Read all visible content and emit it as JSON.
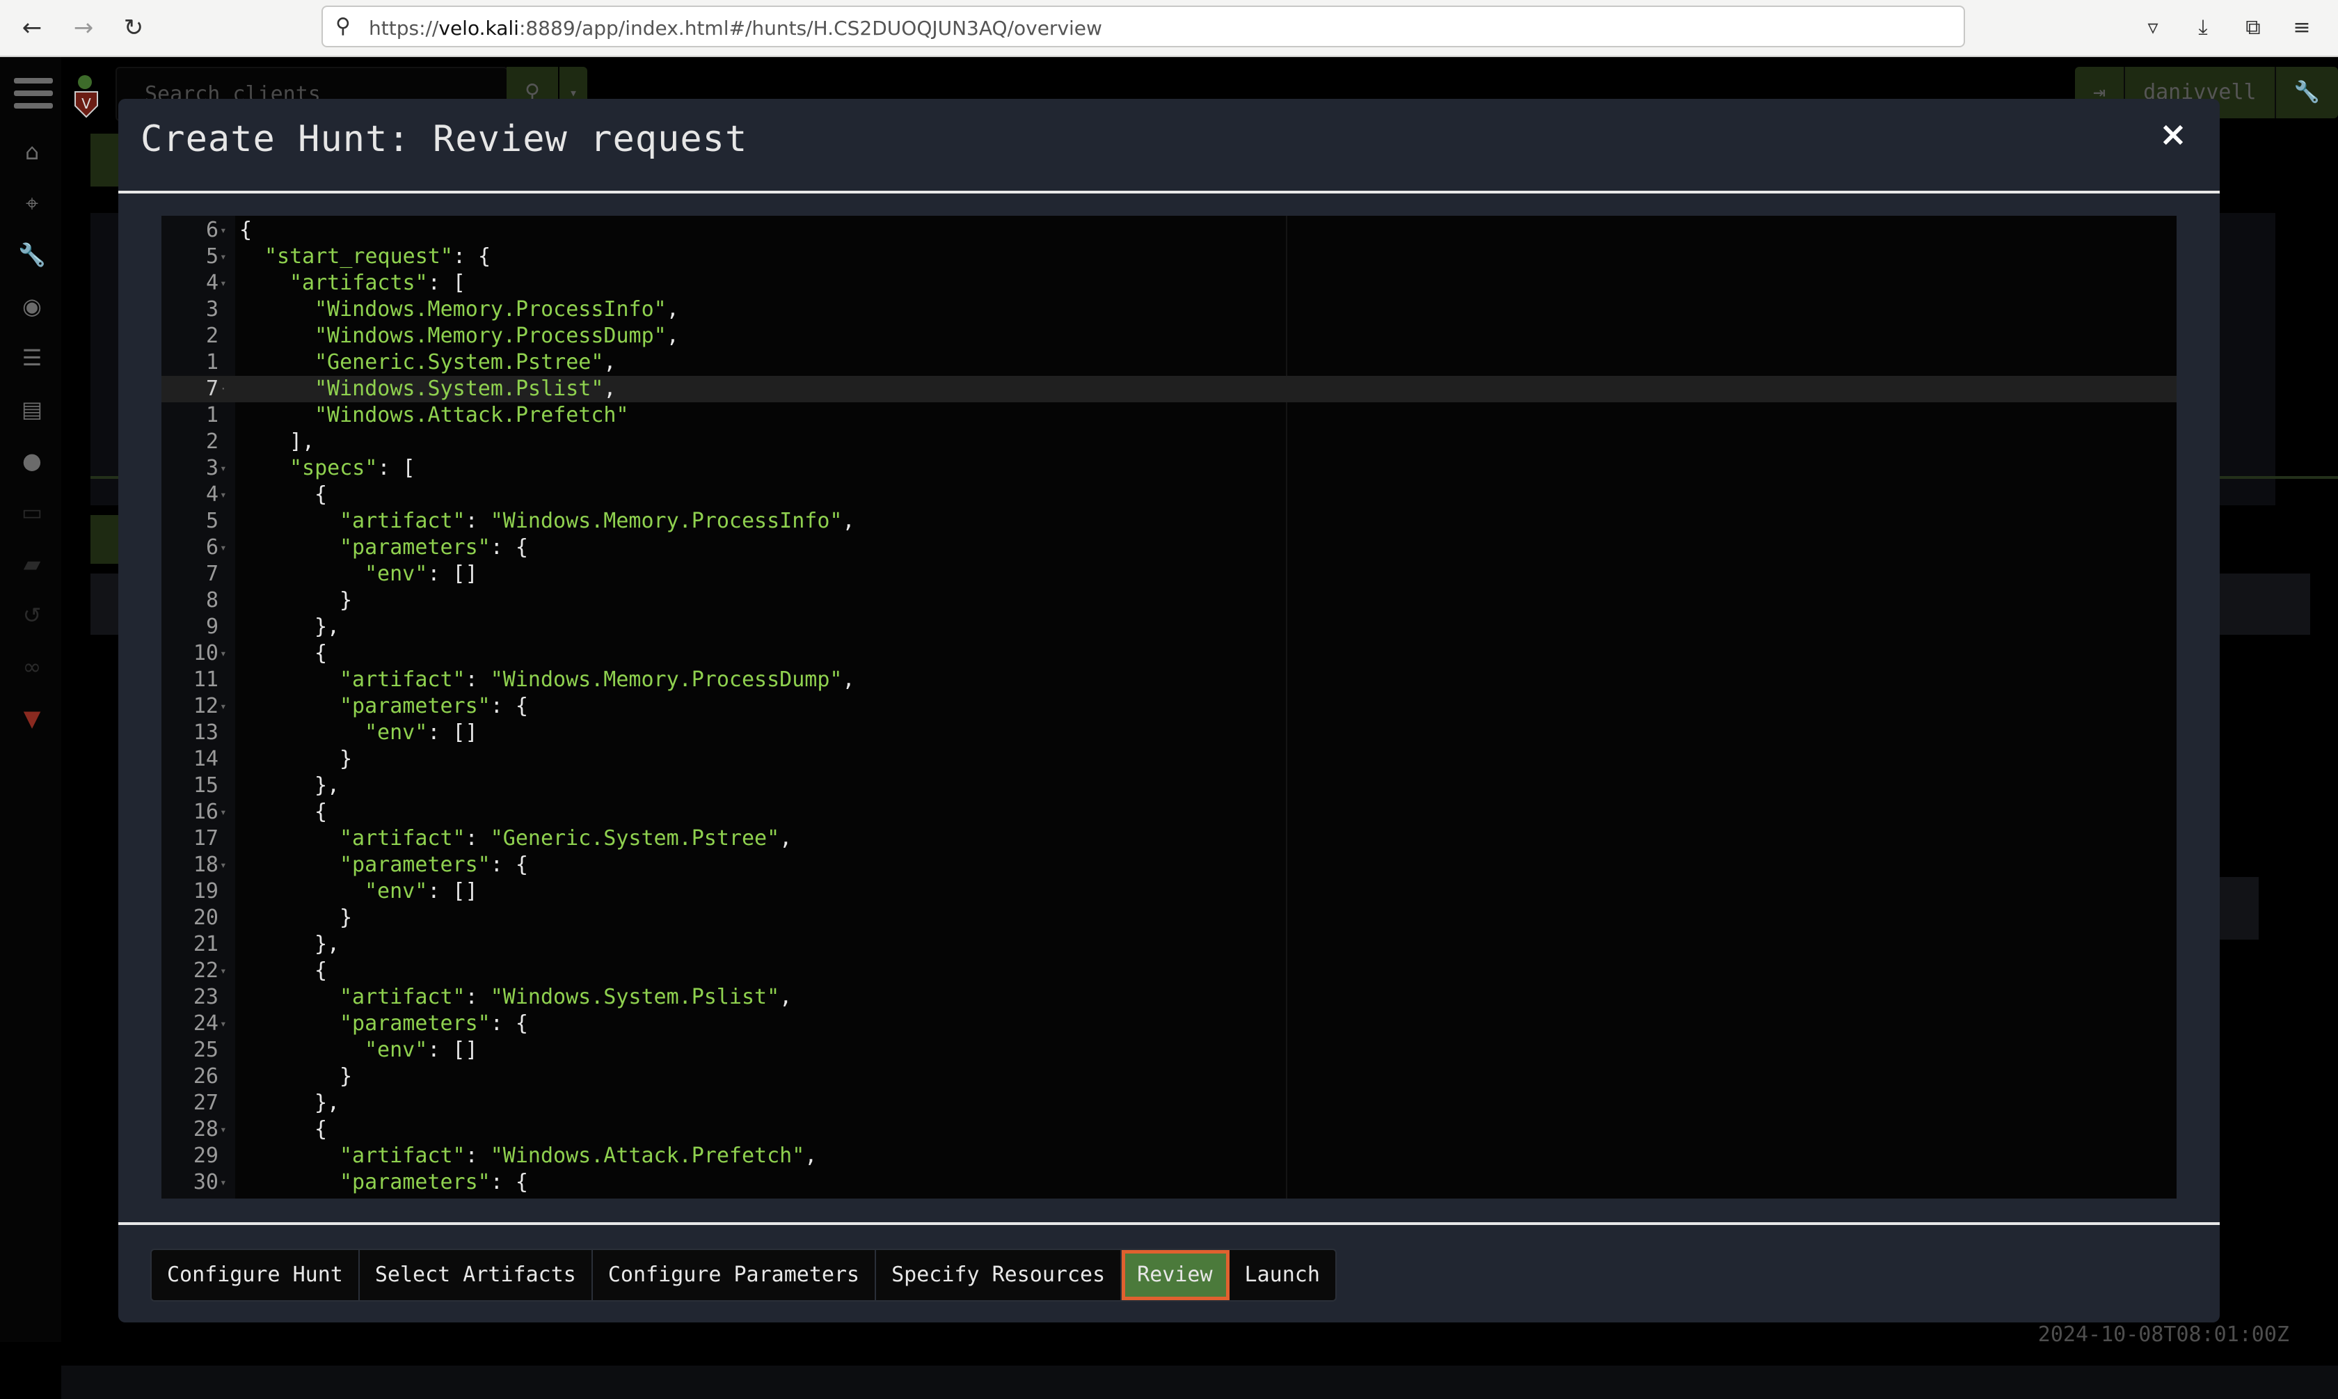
{
  "browser": {
    "url_prefix": "https://",
    "url_host": "velo.kali",
    "url_rest": ":8889/app/index.html#/hunts/H.CS2DUOQJUN3AQ/overview",
    "back_icon": "arrow-left-icon",
    "forward_icon": "arrow-right-icon",
    "reload_icon": "reload-icon",
    "toolbar_icons": [
      "pocket-icon",
      "download-icon",
      "extensions-icon",
      "menu-icon"
    ]
  },
  "app": {
    "search_placeholder": "Search clients",
    "username": "danivvell",
    "footer_time": "2024-10-08T08:01:00Z",
    "sidebar_icons": [
      "home-icon",
      "crosshair-icon",
      "wrench-icon",
      "eye-icon",
      "server-icon",
      "book-icon",
      "user-icon",
      "laptop-icon",
      "folder-icon",
      "history-icon",
      "binoculars-icon",
      "velociraptor-icon"
    ]
  },
  "modal": {
    "title": "Create Hunt: Review request",
    "close_label": "×",
    "editor": {
      "lines": [
        {
          "n": "6",
          "fold": true,
          "indent": 0,
          "parts": [
            [
              "p",
              "{"
            ]
          ]
        },
        {
          "n": "5",
          "fold": true,
          "indent": 1,
          "parts": [
            [
              "s",
              "\"start_request\""
            ],
            [
              "p",
              ": {"
            ]
          ]
        },
        {
          "n": "4",
          "fold": true,
          "indent": 2,
          "parts": [
            [
              "s",
              "\"artifacts\""
            ],
            [
              "p",
              ": ["
            ]
          ]
        },
        {
          "n": "3",
          "fold": false,
          "indent": 3,
          "parts": [
            [
              "s",
              "\"Windows.Memory.ProcessInfo\""
            ],
            [
              "p",
              ","
            ]
          ]
        },
        {
          "n": "2",
          "fold": false,
          "indent": 3,
          "parts": [
            [
              "s",
              "\"Windows.Memory.ProcessDump\""
            ],
            [
              "p",
              ","
            ]
          ]
        },
        {
          "n": "1",
          "fold": false,
          "indent": 3,
          "parts": [
            [
              "s",
              "\"Generic.System.Pstree\""
            ],
            [
              "p",
              ","
            ]
          ]
        },
        {
          "n": "7",
          "fold": false,
          "indent": 3,
          "active": true,
          "parts": [
            [
              "s",
              "\"Windows.System.Pslist\""
            ],
            [
              "p",
              ","
            ]
          ]
        },
        {
          "n": "1",
          "fold": false,
          "indent": 3,
          "parts": [
            [
              "s",
              "\"Windows.Attack.Prefetch\""
            ]
          ]
        },
        {
          "n": "2",
          "fold": false,
          "indent": 2,
          "parts": [
            [
              "p",
              "],"
            ]
          ]
        },
        {
          "n": "3",
          "fold": true,
          "indent": 2,
          "parts": [
            [
              "s",
              "\"specs\""
            ],
            [
              "p",
              ": ["
            ]
          ]
        },
        {
          "n": "4",
          "fold": true,
          "indent": 3,
          "parts": [
            [
              "p",
              "{"
            ]
          ]
        },
        {
          "n": "5",
          "fold": false,
          "indent": 4,
          "parts": [
            [
              "s",
              "\"artifact\""
            ],
            [
              "p",
              ": "
            ],
            [
              "s",
              "\"Windows.Memory.ProcessInfo\""
            ],
            [
              "p",
              ","
            ]
          ]
        },
        {
          "n": "6",
          "fold": true,
          "indent": 4,
          "parts": [
            [
              "s",
              "\"parameters\""
            ],
            [
              "p",
              ": {"
            ]
          ]
        },
        {
          "n": "7",
          "fold": false,
          "indent": 5,
          "parts": [
            [
              "s",
              "\"env\""
            ],
            [
              "p",
              ": []"
            ]
          ]
        },
        {
          "n": "8",
          "fold": false,
          "indent": 4,
          "parts": [
            [
              "p",
              "}"
            ]
          ]
        },
        {
          "n": "9",
          "fold": false,
          "indent": 3,
          "parts": [
            [
              "p",
              "},"
            ]
          ]
        },
        {
          "n": "10",
          "fold": true,
          "indent": 3,
          "parts": [
            [
              "p",
              "{"
            ]
          ]
        },
        {
          "n": "11",
          "fold": false,
          "indent": 4,
          "parts": [
            [
              "s",
              "\"artifact\""
            ],
            [
              "p",
              ": "
            ],
            [
              "s",
              "\"Windows.Memory.ProcessDump\""
            ],
            [
              "p",
              ","
            ]
          ]
        },
        {
          "n": "12",
          "fold": true,
          "indent": 4,
          "parts": [
            [
              "s",
              "\"parameters\""
            ],
            [
              "p",
              ": {"
            ]
          ]
        },
        {
          "n": "13",
          "fold": false,
          "indent": 5,
          "parts": [
            [
              "s",
              "\"env\""
            ],
            [
              "p",
              ": []"
            ]
          ]
        },
        {
          "n": "14",
          "fold": false,
          "indent": 4,
          "parts": [
            [
              "p",
              "}"
            ]
          ]
        },
        {
          "n": "15",
          "fold": false,
          "indent": 3,
          "parts": [
            [
              "p",
              "},"
            ]
          ]
        },
        {
          "n": "16",
          "fold": true,
          "indent": 3,
          "parts": [
            [
              "p",
              "{"
            ]
          ]
        },
        {
          "n": "17",
          "fold": false,
          "indent": 4,
          "parts": [
            [
              "s",
              "\"artifact\""
            ],
            [
              "p",
              ": "
            ],
            [
              "s",
              "\"Generic.System.Pstree\""
            ],
            [
              "p",
              ","
            ]
          ]
        },
        {
          "n": "18",
          "fold": true,
          "indent": 4,
          "parts": [
            [
              "s",
              "\"parameters\""
            ],
            [
              "p",
              ": {"
            ]
          ]
        },
        {
          "n": "19",
          "fold": false,
          "indent": 5,
          "parts": [
            [
              "s",
              "\"env\""
            ],
            [
              "p",
              ": []"
            ]
          ]
        },
        {
          "n": "20",
          "fold": false,
          "indent": 4,
          "parts": [
            [
              "p",
              "}"
            ]
          ]
        },
        {
          "n": "21",
          "fold": false,
          "indent": 3,
          "parts": [
            [
              "p",
              "},"
            ]
          ]
        },
        {
          "n": "22",
          "fold": true,
          "indent": 3,
          "parts": [
            [
              "p",
              "{"
            ]
          ]
        },
        {
          "n": "23",
          "fold": false,
          "indent": 4,
          "parts": [
            [
              "s",
              "\"artifact\""
            ],
            [
              "p",
              ": "
            ],
            [
              "s",
              "\"Windows.System.Pslist\""
            ],
            [
              "p",
              ","
            ]
          ]
        },
        {
          "n": "24",
          "fold": true,
          "indent": 4,
          "parts": [
            [
              "s",
              "\"parameters\""
            ],
            [
              "p",
              ": {"
            ]
          ]
        },
        {
          "n": "25",
          "fold": false,
          "indent": 5,
          "parts": [
            [
              "s",
              "\"env\""
            ],
            [
              "p",
              ": []"
            ]
          ]
        },
        {
          "n": "26",
          "fold": false,
          "indent": 4,
          "parts": [
            [
              "p",
              "}"
            ]
          ]
        },
        {
          "n": "27",
          "fold": false,
          "indent": 3,
          "parts": [
            [
              "p",
              "},"
            ]
          ]
        },
        {
          "n": "28",
          "fold": true,
          "indent": 3,
          "parts": [
            [
              "p",
              "{"
            ]
          ]
        },
        {
          "n": "29",
          "fold": false,
          "indent": 4,
          "parts": [
            [
              "s",
              "\"artifact\""
            ],
            [
              "p",
              ": "
            ],
            [
              "s",
              "\"Windows.Attack.Prefetch\""
            ],
            [
              "p",
              ","
            ]
          ]
        },
        {
          "n": "30",
          "fold": true,
          "indent": 4,
          "parts": [
            [
              "s",
              "\"parameters\""
            ],
            [
              "p",
              ": {"
            ]
          ]
        }
      ]
    },
    "steps": [
      {
        "label": "Configure Hunt",
        "current": false
      },
      {
        "label": "Select Artifacts",
        "current": false
      },
      {
        "label": "Configure Parameters",
        "current": false
      },
      {
        "label": "Specify Resources",
        "current": false
      },
      {
        "label": "Review",
        "current": true
      },
      {
        "label": "Launch",
        "current": false
      }
    ]
  }
}
